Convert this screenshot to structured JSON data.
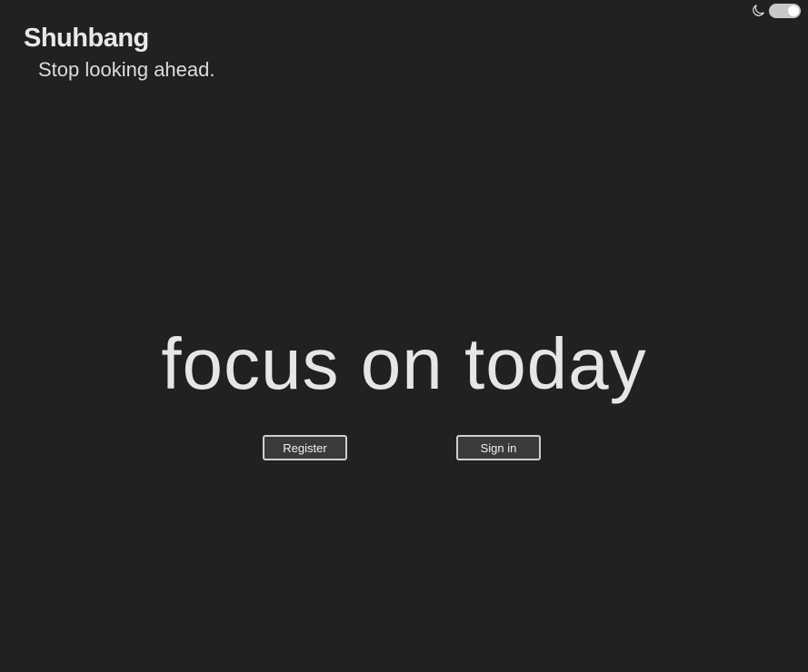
{
  "header": {
    "title": "Shuhbang",
    "tagline": "Stop looking ahead."
  },
  "theme_toggle": {
    "icon": "moon-icon",
    "enabled": true
  },
  "hero": {
    "headline": "focus on today"
  },
  "actions": {
    "register_label": "Register",
    "signin_label": "Sign in"
  },
  "colors": {
    "background": "#212121",
    "text": "#e6e6e6",
    "button_background": "#3a3a3a",
    "button_border": "#cfcfcf"
  }
}
